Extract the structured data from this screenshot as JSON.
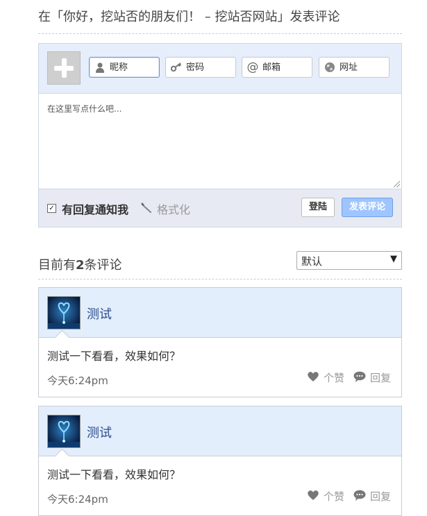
{
  "reply_title": "在「你好，挖站否的朋友们！ – 挖站否网站」发表评论",
  "form": {
    "fields": [
      {
        "name": "nickname",
        "icon": "user-icon",
        "placeholder": "昵称",
        "active": true
      },
      {
        "name": "password",
        "icon": "key-icon",
        "placeholder": "密码",
        "active": false
      },
      {
        "name": "email",
        "icon": "at-icon",
        "placeholder": "邮箱",
        "active": false
      },
      {
        "name": "website",
        "icon": "globe-icon",
        "placeholder": "网址",
        "active": false
      }
    ],
    "textarea_placeholder": "在这里写点什么吧...",
    "notify_checked": true,
    "notify_label": "有回复通知我",
    "format_label": "格式化",
    "login_label": "登陆",
    "submit_label": "发表评论"
  },
  "count": {
    "prefix": "目前有",
    "number": "2",
    "suffix": "条评论"
  },
  "sort": {
    "selected": "默认"
  },
  "comments": [
    {
      "author": "测试",
      "text": "测试一下看看，效果如何？",
      "time": "今天6:24pm",
      "like_label": "个赞",
      "reply_label": "回复"
    },
    {
      "author": "测试",
      "text": "测试一下看看，效果如何？",
      "time": "今天6:24pm",
      "like_label": "个赞",
      "reply_label": "回复"
    }
  ],
  "colors": {
    "form_bg": "#e6eefb",
    "submit_bg": "#9ec5ff",
    "comment_head_bg": "#e3eefc",
    "author_color": "#2a4b8d"
  }
}
